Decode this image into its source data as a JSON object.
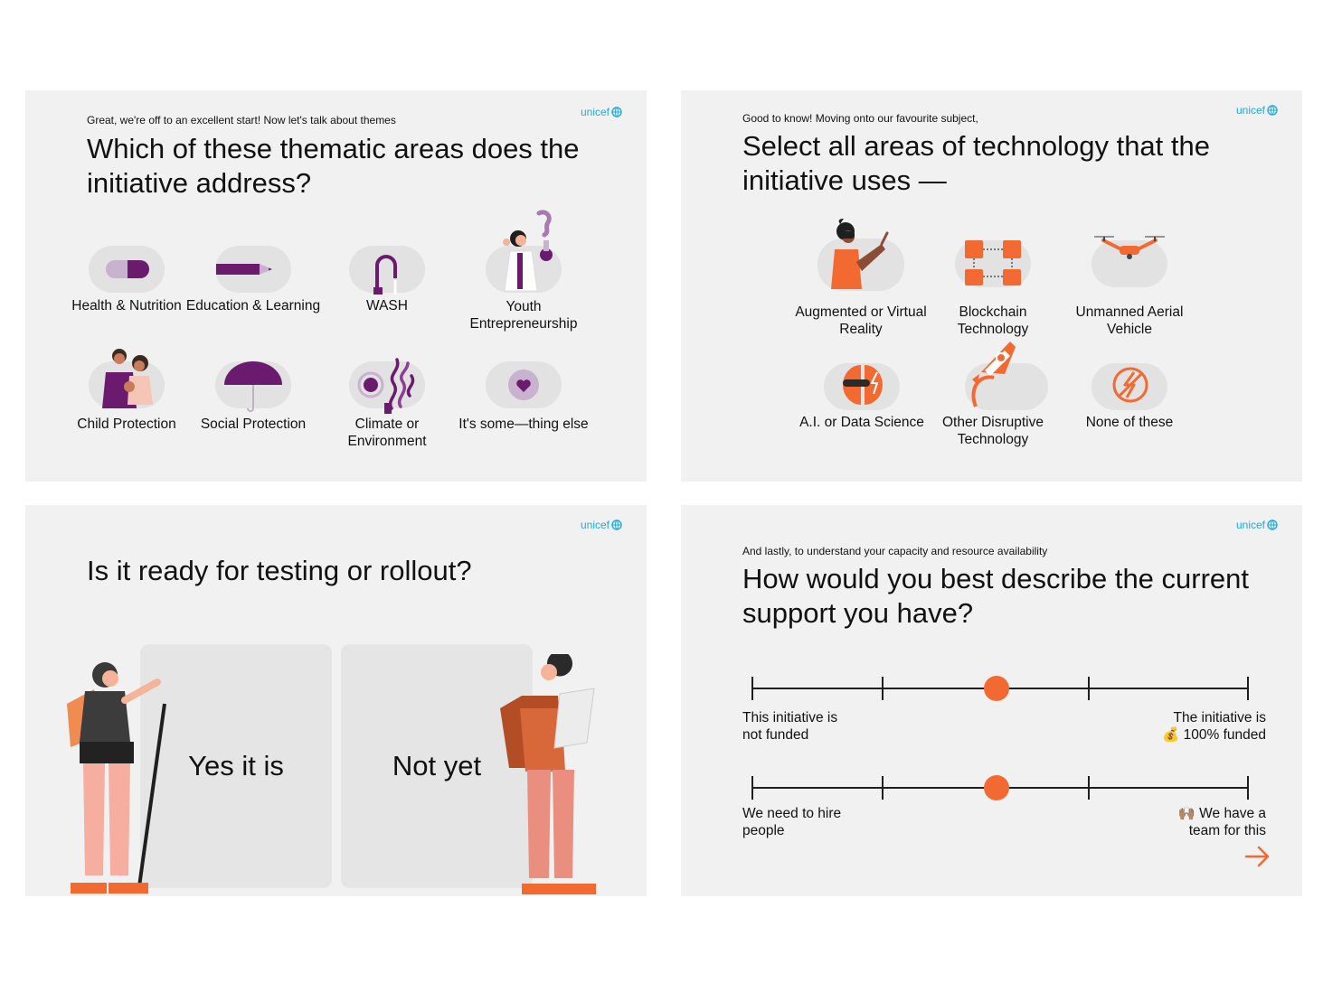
{
  "brand": {
    "logo_text": "unicef",
    "accent": "#1cabe2"
  },
  "colors": {
    "orange": "#f26a32",
    "purple": "#6a1b6e",
    "panel": "#f1f1f1",
    "blob": "#e2e2e2"
  },
  "panel1": {
    "intro": "Great, we're off to an excellent start! Now let's talk about themes",
    "title": "Which of these thematic areas does the initiative address?",
    "options": [
      {
        "label": "Health & Nutrition",
        "icon": "pill-icon"
      },
      {
        "label": "Education & Learning",
        "icon": "pencil-icon"
      },
      {
        "label": "WASH",
        "icon": "faucet-icon"
      },
      {
        "label": "Youth Entrepreneurship",
        "icon": "scientist-icon"
      },
      {
        "label": "Child Protection",
        "icon": "family-icon"
      },
      {
        "label": "Social Protection",
        "icon": "umbrella-icon"
      },
      {
        "label": "Climate or Environment",
        "icon": "smoke-icon"
      },
      {
        "label": "It's some—thing else",
        "icon": "heart-bubble-icon"
      }
    ]
  },
  "panel2": {
    "intro": "Good to know! Moving onto our favourite subject,",
    "title": "Select all areas of technology that the initiative uses —",
    "options": [
      {
        "label": "Augmented or Virtual Reality",
        "icon": "vr-headset-icon"
      },
      {
        "label": "Blockchain Technology",
        "icon": "blockchain-icon"
      },
      {
        "label": "Unmanned Aerial Vehicle",
        "icon": "drone-icon"
      },
      {
        "label": "A.I. or Data Science",
        "icon": "ai-head-icon"
      },
      {
        "label": "Other Disruptive Technology",
        "icon": "rocket-icon"
      },
      {
        "label": "None of these",
        "icon": "no-lightning-icon"
      }
    ]
  },
  "panel3": {
    "title": "Is it ready for testing or rollout?",
    "yes_label": "Yes it is",
    "no_label": "Not yet"
  },
  "panel4": {
    "intro": "And lastly, to understand your capacity and resource availability",
    "title": "How would you best describe the current support you have?",
    "sliders": [
      {
        "left_label": "This initiative is not funded",
        "right_label": "💰 100% funded",
        "right_label_top": "The initiative is",
        "value": 0.5,
        "ticks": 5
      },
      {
        "left_label": "We need to hire people",
        "right_label": "🙌🏽 We have a",
        "right_label_bottom": "team for this",
        "value": 0.5,
        "ticks": 5
      }
    ],
    "next_icon": "arrow-right-icon"
  }
}
